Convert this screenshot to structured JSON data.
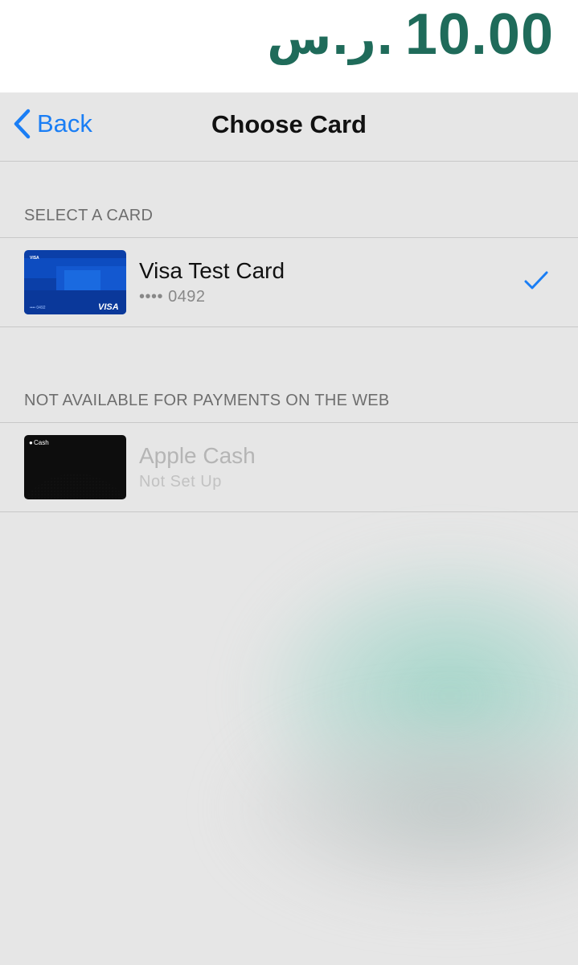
{
  "amount": {
    "value": "10.00",
    "currency": "ر.س."
  },
  "nav": {
    "back_label": "Back",
    "title": "Choose Card"
  },
  "sections": [
    {
      "header": "SELECT A CARD",
      "cards": [
        {
          "name": "Visa Test Card",
          "detail": "•••• 0492",
          "thumb_brand": "VISA",
          "thumb_number": "•••• 0492",
          "selected": true,
          "icon": "checkmark-icon"
        }
      ]
    },
    {
      "header": "NOT AVAILABLE FOR PAYMENTS ON THE WEB",
      "cards": [
        {
          "name": "Apple Cash",
          "detail": "Not Set Up",
          "thumb_brand": "Cash",
          "selected": false
        }
      ]
    }
  ],
  "colors": {
    "accent": "#1a7ef5",
    "amount": "#1f6b5a",
    "sheet_bg": "#e6e6e6",
    "separator": "#c8c8c8"
  }
}
